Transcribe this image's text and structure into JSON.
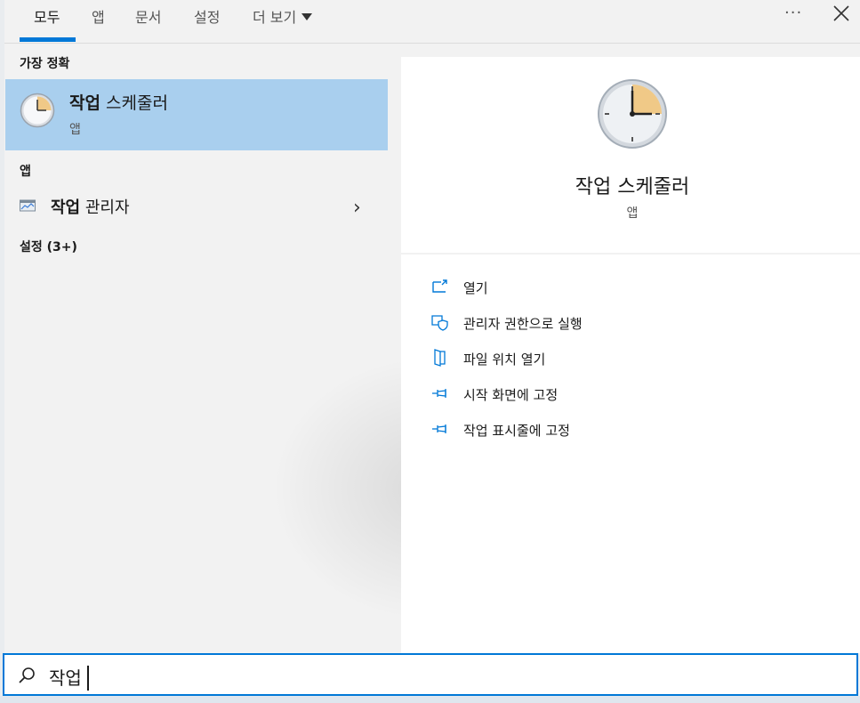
{
  "tabs": [
    {
      "label": "모두"
    },
    {
      "label": "앱"
    },
    {
      "label": "문서"
    },
    {
      "label": "설정"
    },
    {
      "label": "더 보기"
    }
  ],
  "more_options": "···",
  "left": {
    "best_match_heading": "가장 정확",
    "best_match": {
      "name_bold": "작업",
      "name_rest": " 스케줄러",
      "type": "앱"
    },
    "apps_heading": "앱",
    "apps": [
      {
        "name_bold": "작업",
        "name_rest": " 관리자"
      }
    ],
    "settings_heading": "설정 (3+)"
  },
  "right": {
    "app_name": "작업 스케줄러",
    "app_type": "앱",
    "actions": [
      {
        "label": "열기",
        "icon": "open-icon"
      },
      {
        "label": "관리자 권한으로 실행",
        "icon": "shield-icon"
      },
      {
        "label": "파일 위치 열기",
        "icon": "file-location-icon"
      },
      {
        "label": "시작 화면에 고정",
        "icon": "pin-icon"
      },
      {
        "label": "작업 표시줄에 고정",
        "icon": "pin-icon"
      }
    ]
  },
  "search": {
    "value": "작업"
  },
  "colors": {
    "accent": "#0078d7",
    "selected": "#a9cfee"
  }
}
